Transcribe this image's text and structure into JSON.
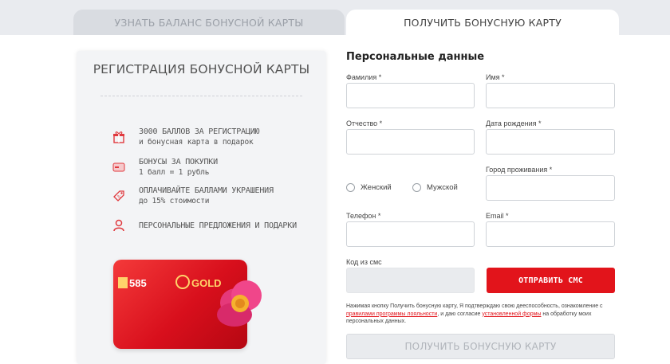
{
  "tabs": [
    {
      "label": "УЗНАТЬ БАЛАНС БОНУСНОЙ КАРТЫ"
    },
    {
      "label": "ПОЛУЧИТЬ БОНУСНУЮ КАРТУ"
    }
  ],
  "left": {
    "title": "РЕГИСТРАЦИЯ БОНУСНОЙ КАРТЫ",
    "benefits": [
      {
        "icon": "gift-icon",
        "main": "3000 БАЛЛОВ ЗА РЕГИСТРАЦИЮ",
        "sub": "и бонусная карта в подарок"
      },
      {
        "icon": "card-icon",
        "main": "БОНУСЫ ЗА ПОКУПКИ",
        "sub": "1 балл = 1 рубль"
      },
      {
        "icon": "tag-icon",
        "main": "ОПЛАЧИВАЙТЕ БАЛЛАМИ УКРАШЕНИЯ",
        "sub": "до 15% стоимости"
      },
      {
        "icon": "user-icon",
        "main": "ПЕРСОНАЛЬНЫЕ ПРЕДЛОЖЕНИЯ И ПОДАРКИ",
        "sub": ""
      }
    ],
    "card": {
      "brand": "585",
      "brand2": "GOLD"
    }
  },
  "form": {
    "title": "Персональные данные",
    "surname_label": "Фамилия *",
    "name_label": "Имя *",
    "patronymic_label": "Отчество *",
    "birthdate_label": "Дата рождения *",
    "city_label": "Город проживания *",
    "gender_female": "Женский",
    "gender_male": "Мужской",
    "phone_label": "Телефон *",
    "email_label": "Email *",
    "sms_label": "Код из смс",
    "send_sms": "ОТПРАВИТЬ СМС",
    "consent_1": "Нажимая кнопку Получить бонусную карту, Я подтверждаю свою дееспособность, ознакомление с ",
    "consent_link1": "правилами программы лояльности",
    "consent_2": ", и даю согласие ",
    "consent_link2": "установленной формы",
    "consent_3": " на обработку моих персональных данных.",
    "submit": "ПОЛУЧИТЬ БОНУСНУЮ КАРТУ"
  },
  "colors": {
    "accent": "#e2141b",
    "panel": "#f3f4f6"
  }
}
